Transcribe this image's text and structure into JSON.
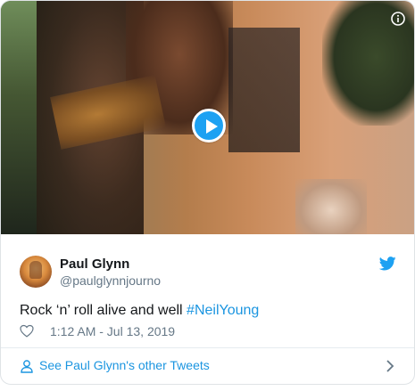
{
  "media": {
    "play_icon": "play-icon",
    "info_icon": "info-icon"
  },
  "author": {
    "name": "Paul Glynn",
    "handle": "@paulglynnjourno",
    "brand_icon": "twitter-bird-icon"
  },
  "tweet": {
    "text_prefix": "Rock ‘n’ roll alive and well ",
    "hashtag": "#NeilYoung",
    "timestamp": "1:12 AM - Jul 13, 2019",
    "like_icon": "heart-icon"
  },
  "footer": {
    "label": "See Paul Glynn's other Tweets",
    "icon": "person-icon",
    "chevron": "chevron-right-icon"
  },
  "colors": {
    "accent": "#1da1f2",
    "link": "#1b95e0",
    "muted": "#657786",
    "text": "#14171a",
    "border": "#dfe3e6"
  }
}
